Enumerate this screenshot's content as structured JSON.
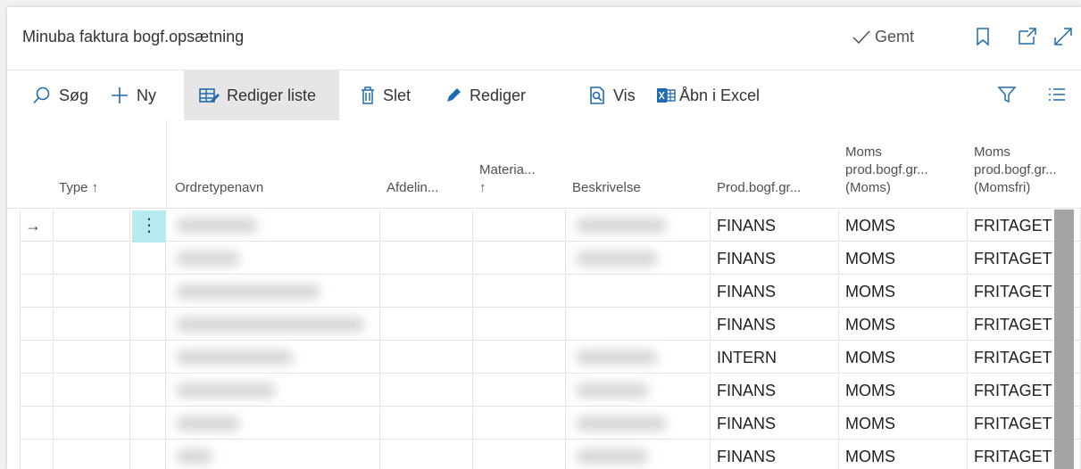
{
  "header": {
    "title": "Minuba faktura bogf.opsætning",
    "saved_label": "Gemt"
  },
  "toolbar": {
    "search_label": "Søg",
    "new_label": "Ny",
    "edit_list_label": "Rediger liste",
    "delete_label": "Slet",
    "edit_label": "Rediger",
    "view_label": "Vis",
    "excel_label": "Åbn i Excel"
  },
  "columns": {
    "type": "Type ↑",
    "order_type_name": "Ordretypenavn",
    "department": "Afdelin...",
    "material_1": "Materia...",
    "material_2": "↑",
    "description": "Beskrivelse",
    "prod_posting_group": "Prod.bogf.gr...",
    "vat_prod_1": "Moms",
    "vat_prod_2": "prod.bogf.gr...",
    "vat_prod_3": "(Moms)",
    "vat_free_1": "Moms",
    "vat_free_2": "prod.bogf.gr...",
    "vat_free_3": "(Momsfri)"
  },
  "rows": [
    {
      "prod": "FINANS",
      "moms": "MOMS",
      "momsfri": "FRITAGET"
    },
    {
      "prod": "FINANS",
      "moms": "MOMS",
      "momsfri": "FRITAGET"
    },
    {
      "prod": "FINANS",
      "moms": "MOMS",
      "momsfri": "FRITAGET"
    },
    {
      "prod": "FINANS",
      "moms": "MOMS",
      "momsfri": "FRITAGET"
    },
    {
      "prod": "INTERN",
      "moms": "MOMS",
      "momsfri": "FRITAGET"
    },
    {
      "prod": "FINANS",
      "moms": "MOMS",
      "momsfri": "FRITAGET"
    },
    {
      "prod": "FINANS",
      "moms": "MOMS",
      "momsfri": "FRITAGET"
    },
    {
      "prod": "FINANS",
      "moms": "MOMS",
      "momsfri": "FRITAGET"
    }
  ],
  "colors": {
    "accent": "#1f6bb3",
    "selected_cell": "#b6ecf0",
    "active_tool": "#e6e6e6"
  }
}
